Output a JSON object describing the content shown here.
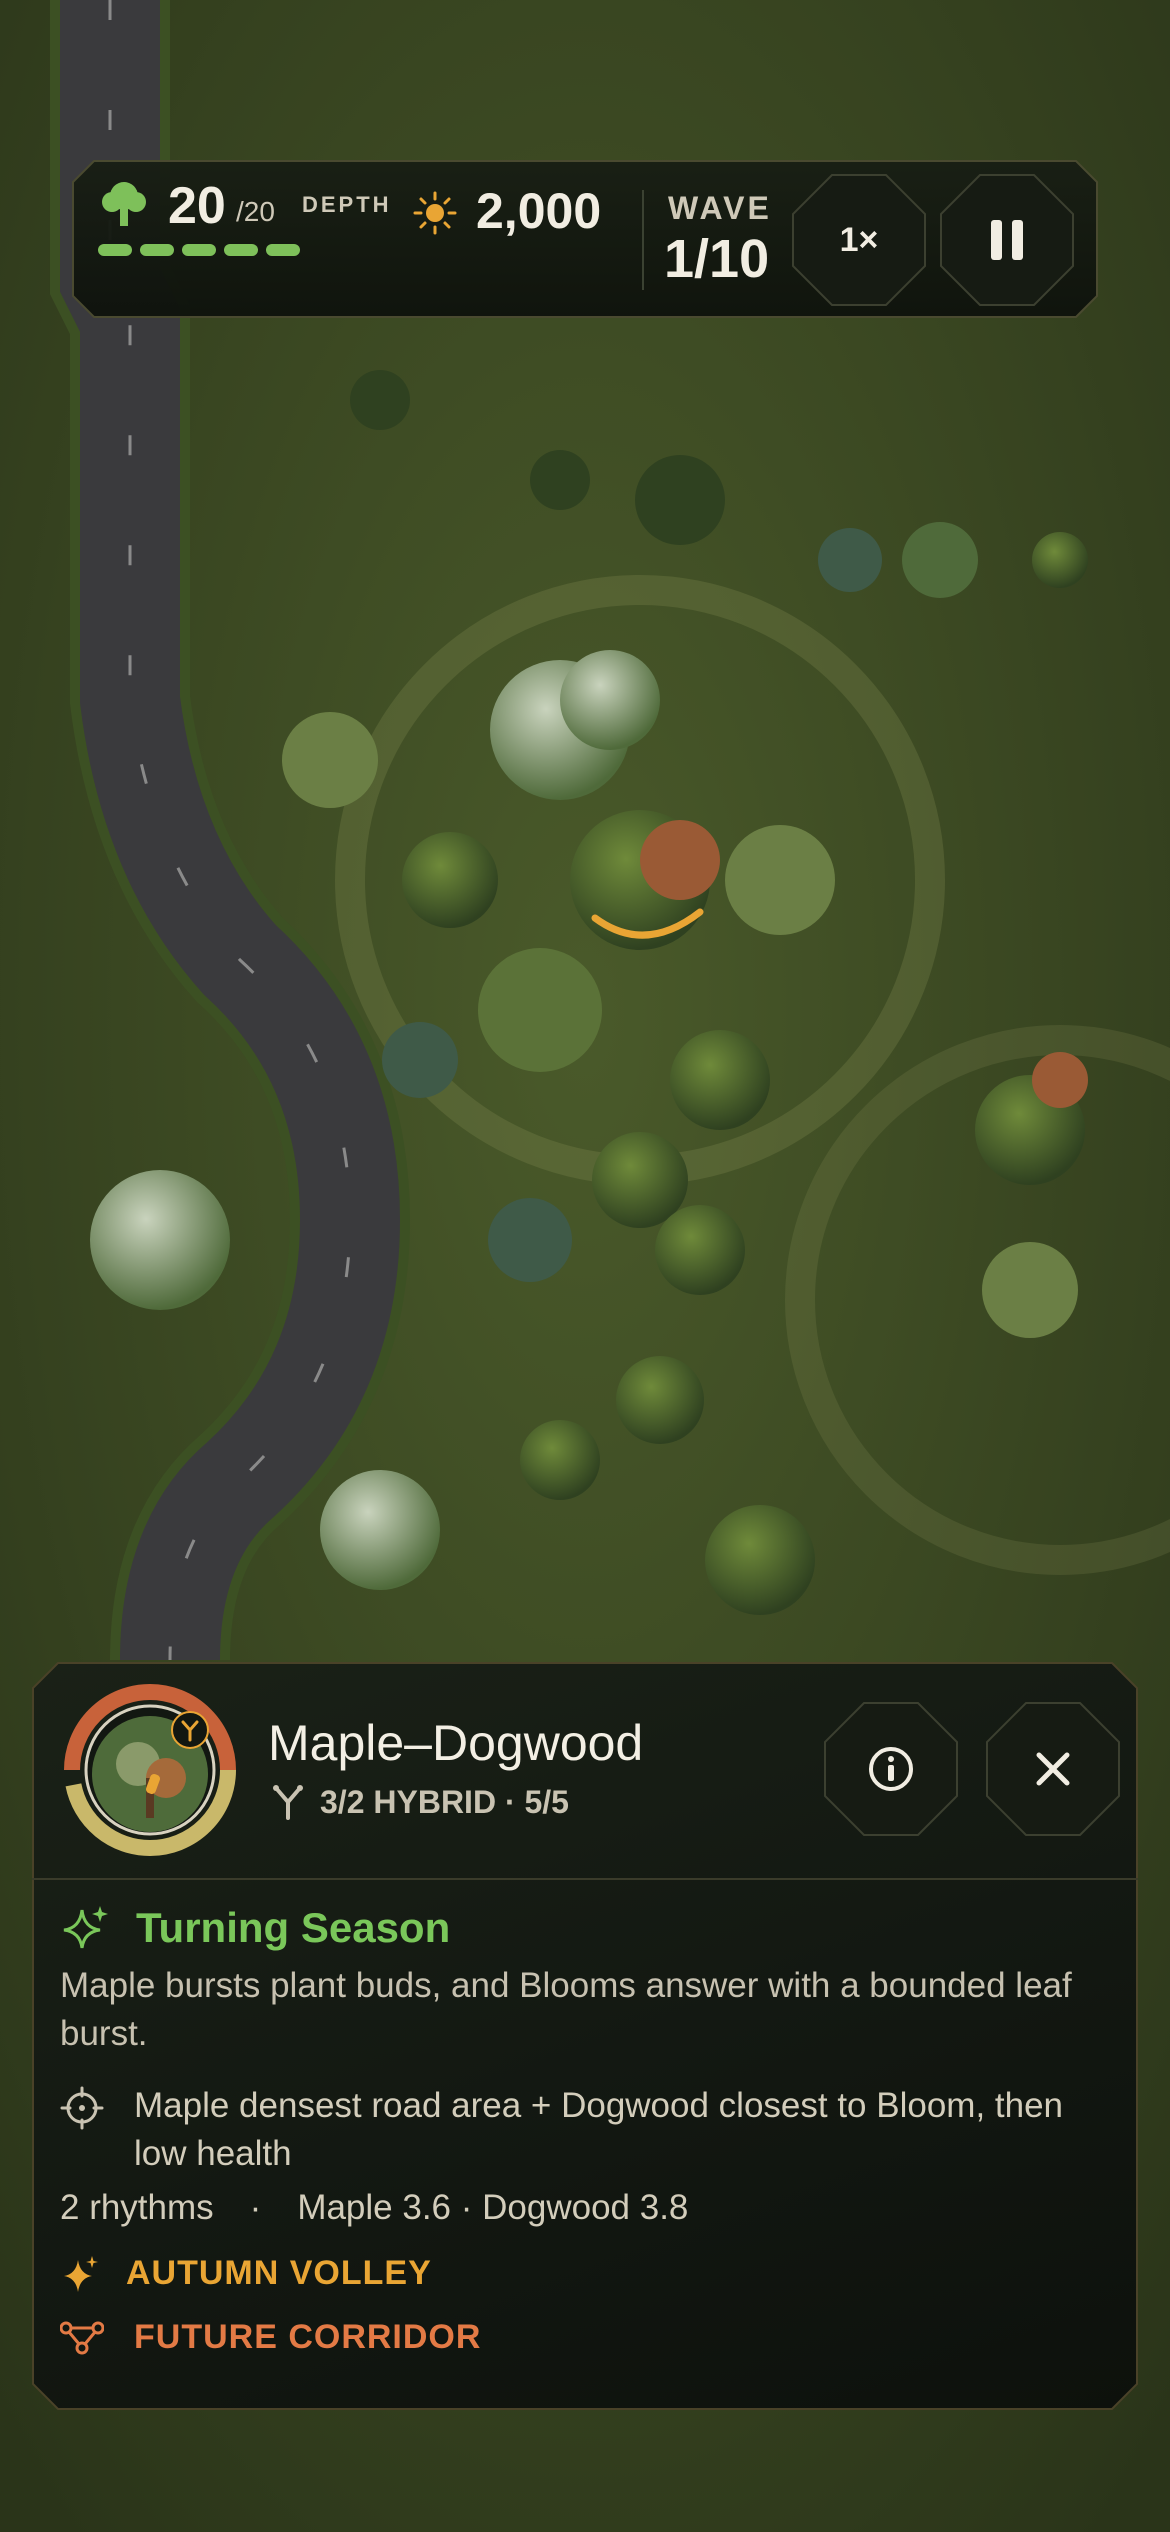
{
  "hud": {
    "health_value": "20",
    "health_max": "/20",
    "health_segments": 5,
    "depth_label": "DEPTH",
    "gold_value": "2,000",
    "wave_label": "WAVE",
    "wave_value": "1/10",
    "speed_label": "1×",
    "pause_icon": "pause-icon",
    "health_icon": "tree-icon",
    "gold_icon": "sun-icon"
  },
  "panel": {
    "unit_name": "Maple–Dogwood",
    "unit_meta": "3/2 HYBRID · 5/5",
    "hybrid_icon": "hybrid-fork-icon",
    "info_icon": "info-icon",
    "close_icon": "close-icon",
    "ability": {
      "name": "Turning Season",
      "description": "Maple bursts plant buds, and Blooms answer with a bounded leaf burst.",
      "targeting": "Maple densest road area + Dogwood closest to Bloom, then low health"
    },
    "stats": {
      "rhythms": "2 rhythms",
      "separator": "·",
      "rates": "Maple 3.6 · Dogwood 3.8"
    },
    "tags": [
      {
        "label": "AUTUMN VOLLEY",
        "icon": "sparkle-icon",
        "color": "#e9a534"
      },
      {
        "label": "FUTURE CORRIDOR",
        "icon": "corridor-icon",
        "color": "#e37a45"
      }
    ]
  },
  "colors": {
    "accent_green": "#7ac75a",
    "accent_gold": "#e9a534",
    "accent_orange": "#e37a45",
    "hud_bg": "#161b13"
  }
}
